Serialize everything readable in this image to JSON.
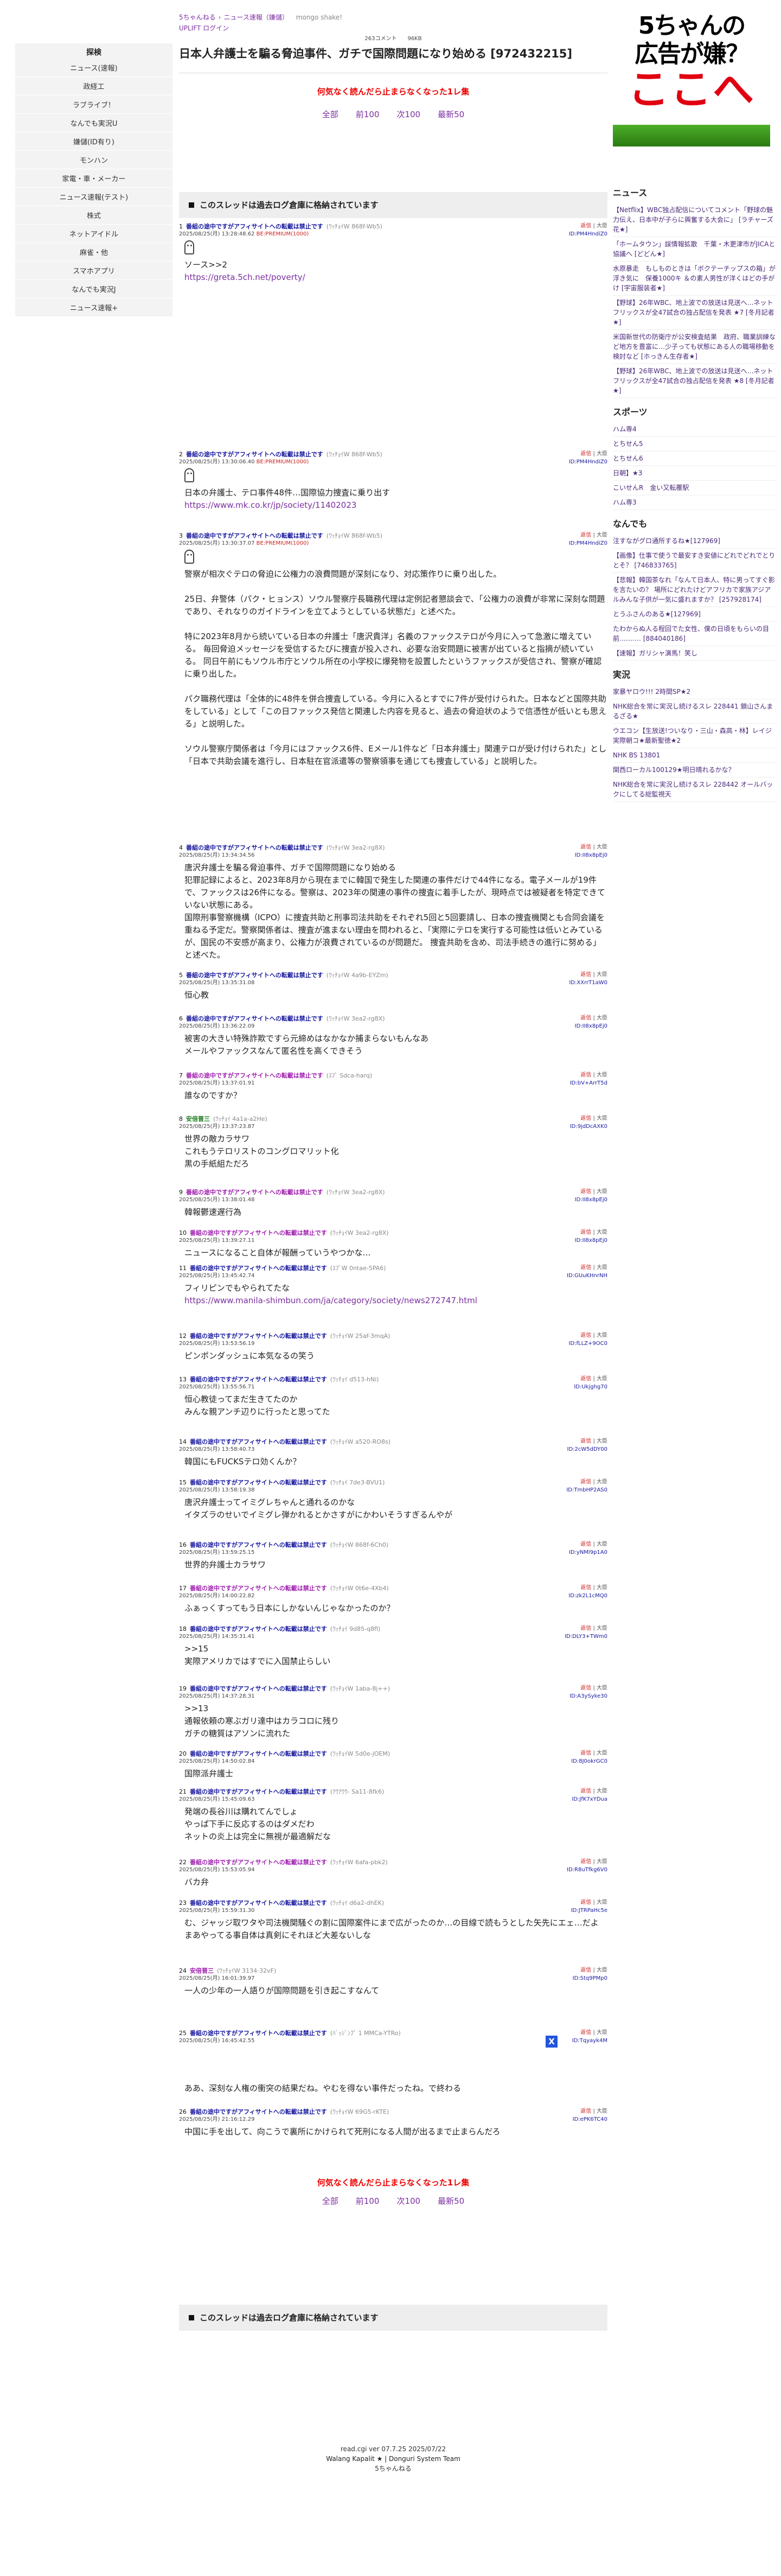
{
  "leftnav": {
    "title": "探検",
    "items": [
      "ニュース(速報)",
      "政経工",
      "ラブライブ！",
      "なんでも実況U",
      "嫌儲(ID有り)",
      "モンハン",
      "家電・車・メーカー",
      "ニュース速報(テスト)",
      "株式",
      "ネットアイドル",
      "麻雀・他",
      "スマホアプリ",
      "なんでも実況J",
      "ニュース速報+"
    ]
  },
  "crumbs": {
    "home": "5ちゃんねる",
    "board": "ニュース速報（嫌儲）",
    "mongo": "mongo shake!",
    "upliftLabel": "UPLIFT ログイン"
  },
  "thread": {
    "meta": "263コメント　　96KB",
    "title": "日本人弁護士を騙る脅迫事件、ガチで国際問題になり始める [972432215]"
  },
  "warning": "何気なく読んだら止まらなくなった1レ集",
  "pager": {
    "all": "全部",
    "prev100": "前100",
    "next100": "次100",
    "latest50": "最新50"
  },
  "archive_notice": "このスレッドは過去ログ倉庫に格納されています",
  "posts": [
    {
      "num": "1",
      "name": "番組の途中ですがアフィサイトへの転載は禁止です",
      "trip": "(ﾜｯﾁｮｲW 868f-Wb5)",
      "date": "2025/08/25(月) 13:28:48.62",
      "be": "BE:PREMIUM(1000)",
      "id": "ID:PM4HndiZ0",
      "body": [
        "ソース>>2"
      ],
      "link": "https://greta.5ch.net/poverty/",
      "icon": true
    },
    {
      "num": "2",
      "name": "番組の途中ですがアフィサイトへの転載は禁止です",
      "trip": "(ﾜｯﾁｮｲW 868f-Wb5)",
      "date": "2025/08/25(月) 13:30:06.40",
      "be": "BE:PREMIUM(1000)",
      "id": "ID:PM4HndiZ0",
      "body": [
        "日本の弁護士、テロ事件48件…国際協力捜査に乗り出す"
      ],
      "link": "https://www.mk.co.kr/jp/society/11402023",
      "icon": true
    },
    {
      "num": "3",
      "name": "番組の途中ですがアフィサイトへの転載は禁止です",
      "trip": "(ﾜｯﾁｮｲW 868f-Wb5)",
      "date": "2025/08/25(月) 13:30:37.07",
      "be": "BE:PREMIUM(1000)",
      "id": "ID:PM4HndiZ0",
      "icon": true,
      "body": [
        "警察が相次ぐテロの脅迫に公権力の浪費問題が深刻になり、対応策作りに乗り出した。",
        "",
        "25日、弁警体（パク・ヒョンス）ソウル警察庁長職務代理は定例記者懇談会で、「公権力の浪費が非常に深刻な問題であり、それなりのガイドラインを立てようとしている状態だ」と述べた。",
        "",
        "特に2023年8月から続いている日本の弁護士「唐沢貴洋」名義のファックステロが今月に入って急激に増えている。 毎回脅迫メッセージを受信するたびに捜査が投入され、必要な治安問題に被害が出ていると指摘が続いている。 同日午前にもソウル市庁とソウル所在の小学校に爆発物を設置したというファックスが受信され、警察が確認に乗り出した。",
        "",
        "パク職務代理は「全体的に48件を併合捜査している。今月に入るとすでに7件が受付けられた。日本などと国際共助をしている」として「この日ファックス発信と関連した内容を見ると、過去の脅迫状のようで信憑性が低いとも思える」と説明した。",
        "",
        "ソウル警察庁関係者は「今月にはファックス6件、Eメール1件など「日本弁護士」関連テロが受け付けられた」とし「日本で共助会議を進行し、日本駐在官派遣等の警察領事を通じても捜査している」と説明した。"
      ]
    },
    {
      "num": "4",
      "name": "番組の途中ですがアフィサイトへの転載は禁止です",
      "trip": "(ﾜｯﾁｮｲW 3ea2-rg8X)",
      "date": "2025/08/25(月) 13:34:34.56",
      "be": "",
      "id": "ID:II8x8pEj0",
      "body": [
        "唐沢弁護士を騙る脅迫事件、ガチで国際問題になり始める",
        "犯罪記録によると、2023年8月から現在までに韓国で発生した関連の事件だけで44件になる。電子メールが19件で、ファックスは26件になる。警察は、2023年の関連の事件の捜査に着手したが、現時点では被疑者を特定できていない状態にある。",
        "国際刑事警察機構（ICPO）に捜査共助と刑事司法共助をそれぞれ5回と5回要請し、日本の捜査機関とも合同会議を重ねる予定だ。警察関係者は、捜査が進まない理由を問われると、「実際にテロを実行する可能性は低いとみているが、国民の不安感が高まり、公権力が浪費されているのが問題だ。 捜査共助を含め、司法手続きの進行に努める」と述べた。"
      ]
    },
    {
      "num": "5",
      "name": "番組の途中ですがアフィサイトへの転載は禁止です",
      "trip": "(ﾜｯﾁｮｲW 4a9b-EYZm)",
      "date": "2025/08/25(月) 13:35:31.08",
      "be": "",
      "id": "ID:XXrrT1aW0",
      "body": [
        "恒心教"
      ]
    },
    {
      "num": "6",
      "name": "番組の途中ですがアフィサイトへの転載は禁止です",
      "trip": "(ﾜｯﾁｮｲW 3ea2-rg8X)",
      "date": "2025/08/25(月) 13:36:22.09",
      "be": "",
      "id": "ID:II8x8pEj0",
      "body": [
        "被害の大きい特殊詐欺ですら元締めはなかなか捕まらないもんなあ",
        "メールやファックスなんて匿名性を高くできそう"
      ]
    },
    {
      "num": "7",
      "name": "番組の途中ですがアフィサイトへの転載は禁止です",
      "trip": "(ｽﾌﾟ Sdca-harq)",
      "date": "2025/08/25(月) 13:37:01.91",
      "be": "",
      "id": "ID:bV+ArrT5d",
      "body": [
        "誰なのですか？"
      ],
      "purple": true
    },
    {
      "num": "8",
      "name": "安倍晋三",
      "trip": "(ﾜｯﾁｮｲ 4a1a-a2He)",
      "date": "2025/08/25(月) 13:37:23.87",
      "be": "",
      "id": "ID:9jdDcAXK0",
      "body": [
        "世界の敵カラサワ",
        "これもうテロリストのコングロマリット化",
        "黒の手紙組ただろ"
      ],
      "green": true
    },
    {
      "num": "9",
      "name": "番組の途中ですがアフィサイトへの転載は禁止です",
      "trip": "(ﾜｯﾁｮｲW 3ea2-rg8X)",
      "date": "2025/08/25(月) 13:38:01.48",
      "be": "",
      "id": "ID:II8x8pEj0",
      "body": [
        "韓報鬱速遅行為"
      ],
      "purple": true
    },
    {
      "num": "10",
      "name": "番組の途中ですがアフィサイトへの転載は禁止です",
      "trip": "(ﾜｯﾁｮｲW 3ea2-rg8X)",
      "date": "2025/08/25(月) 13:39:27.11",
      "be": "",
      "id": "ID:II8x8pEj0",
      "body": [
        "ニュースになること自体が報酬っていうやつかな…"
      ],
      "purple": true
    },
    {
      "num": "11",
      "name": "番組の途中ですがアフィサイトへの転載は禁止です",
      "trip": "(ｽﾌﾟW 0ntae-5PA6)",
      "date": "2025/08/25(月) 13:45:42.74",
      "be": "",
      "id": "ID:GUuKHnrNH",
      "body": [
        "フィリピンでもやられてたな"
      ],
      "link": "https://www.manila-shimbun.com/ja/category/society/news272747.html"
    },
    {
      "num": "12",
      "name": "番組の途中ですがアフィサイトへの転載は禁止です",
      "trip": "(ﾜｯﾁｮｲW 25af-3mqA)",
      "date": "2025/08/25(月) 13:53:56.19",
      "be": "",
      "id": "ID:fLLZ+9OC0",
      "body": [
        "ピンポンダッシュに本気なるの笑う"
      ]
    },
    {
      "num": "13",
      "name": "番組の途中ですがアフィサイトへの転載は禁止です",
      "trip": "(ﾜｯﾁｮｲ d513-hNi)",
      "date": "2025/08/25(月) 13:55:56.71",
      "be": "",
      "id": "ID:Ukjghg70",
      "body": [
        "恒心教徒ってまだ生きてたのか",
        "みんな親アンチ辺りに行ったと思ってた"
      ]
    },
    {
      "num": "14",
      "name": "番組の途中ですがアフィサイトへの転載は禁止です",
      "trip": "(ﾜｯﾁｮｲW a520-RO8s)",
      "date": "2025/08/25(月) 13:58:40.73",
      "be": "",
      "id": "ID:2cW5dDY00",
      "body": [
        "韓国にもFUCKSテロ効くんか？"
      ]
    },
    {
      "num": "15",
      "name": "番組の途中ですがアフィサイトへの転載は禁止です",
      "trip": "(ﾜｯﾁｮｲ 7de3-BVU1)",
      "date": "2025/08/25(月) 13:58:19.38",
      "be": "",
      "id": "ID:TmbHP2AS0",
      "body": [
        "唐沢弁護士ってイミグレちゃんと通れるのかな",
        "イタズラのせいでイミグレ弾かれるとかさすがにかわいそうすぎるんやが"
      ]
    },
    {
      "num": "16",
      "name": "番組の途中ですがアフィサイトへの転載は禁止です",
      "trip": "(ﾜｯﾁｮｲW 868f-6Ch0)",
      "date": "2025/08/25(月) 13:59:25.15",
      "be": "",
      "id": "ID:yNMl9p1A0",
      "body": [
        "世界的弁護士カラサワ"
      ]
    },
    {
      "num": "17",
      "name": "番組の途中ですがアフィサイトへの転載は禁止です",
      "trip": "(ﾜｯﾁｮｲW 0t6e-4Xb4)",
      "date": "2025/08/25(月) 14:00:22.82",
      "be": "",
      "id": "ID:zk2L1cMQ0",
      "body": [
        "ふぁっくすってもう日本にしかないんじゃなかったのか？"
      ],
      "purple": true
    },
    {
      "num": "18",
      "name": "番組の途中ですがアフィサイトへの転載は禁止です",
      "trip": "(ﾜｯﾁｮｲ 9d85-q8fl)",
      "date": "2025/08/25(月) 14:35:31.41",
      "be": "",
      "id": "ID:DLY3+TWm0",
      "body": [
        ">>15",
        "実際アメリカではすでに入国禁止らしい"
      ]
    },
    {
      "num": "19",
      "name": "番組の途中ですがアフィサイトへの転載は禁止です",
      "trip": "(ﾜｯﾁｮｲW 1aba-8j++)",
      "date": "2025/08/25(月) 14:37:28.31",
      "be": "",
      "id": "ID:A3ySyke30",
      "body": [
        ">>13",
        "通報依頼の寒ぶガリ達中はカラコロに残り",
        "ガチの糖質はアソンに流れた"
      ]
    },
    {
      "num": "20",
      "name": "番組の途中ですがアフィサイトへの転載は禁止です",
      "trip": "(ﾜｯﾁｮｲW 5d0e-jOEM)",
      "date": "2025/08/25(月) 14:50:02.84",
      "be": "",
      "id": "ID:8J0okrGC0",
      "body": [
        "国際派弁護士"
      ]
    },
    {
      "num": "21",
      "name": "番組の途中ですがアフィサイトへの転載は禁止です",
      "trip": "(ｱｳｱｳｳ- Sa11-8fk6)",
      "date": "2025/08/25(月) 15:45:09.63",
      "be": "",
      "id": "ID:JfK7xYDua",
      "body": [
        "発端の長谷川は購れてんでしょ",
        "やっぱ下手に反応するのはダメだわ",
        "ネットの炎上は完全に無視が最適解だな"
      ]
    },
    {
      "num": "22",
      "name": "番組の途中ですがアフィサイトへの転載は禁止です",
      "trip": "(ﾜｯﾁｮｲW 6afa-pbk2)",
      "date": "2025/08/25(月) 15:53:05.94",
      "be": "",
      "id": "ID:R8uTfkg6V0",
      "body": [
        "バカ弁"
      ],
      "purple": true
    },
    {
      "num": "23",
      "name": "番組の途中ですがアフィサイトへの転載は禁止です",
      "trip": "(ﾜｯﾁｮｲ d6a2-dhEK)",
      "date": "2025/08/25(月) 15:59:31.30",
      "be": "",
      "id": "ID:JTRPaHc5e",
      "body": [
        "む、ジャッジ取ワタや司法機関騒ぐの割に国際案件にまで広がったのか…の目線で読もうとした矢先にエェ…だよ",
        "まあやってる事自体は真剣にそれほど大差ないしな"
      ]
    },
    {
      "num": "24",
      "name": "安倍晋三",
      "trip": "(ﾜｯﾁｮｲW 3134-32vF)",
      "date": "2025/08/25(月) 16:01:39.97",
      "be": "",
      "id": "ID:Stq9PMp0",
      "body": [
        "一人の少年の一人語りが国際問題を引き起こすなんて"
      ],
      "purple": true
    },
    {
      "num": "25",
      "name": "番組の途中ですがアフィサイトへの転載は禁止です",
      "trip": "(ﾊﾞｯｼﾞﾝﾌﾟ 1 MMCa-YTRo)",
      "date": "2025/08/25(月) 16:45:42.55",
      "be": "",
      "id": "ID:Tqyayk4M",
      "body": [
        ""
      ]
    },
    {
      "num": "26",
      "name": "番組の途中ですがアフィサイトへの転載は禁止です",
      "trip": "(ﾜｯﾁｮｲW 69G5-rKTE)",
      "date": "2025/08/25(月) 21:16:12.29",
      "be": "",
      "id": "ID:ePK6TC40",
      "body": [
        "中国に手を出して、向こうで裏所にかけられて死刑になる人間が出るまで止まらんだろ"
      ]
    }
  ],
  "post25_overflow": "ああ、深刻な人権の衝突の結果だね。やむを得ない事件だったね。で終わる",
  "sidebar": {
    "ad": {
      "line1": "5ちゃんの",
      "line2": "広告が嫌？",
      "line3": "ここへ"
    },
    "news_title": "ニュース",
    "news": [
      "【Netflix】WBC独占配信についてコメント「野球の魅力伝え、日本中が子らに興奮する大会に」 [ラチャーズ花★]",
      "「ホームタウン」誤情報拡散　千葉・木更津市がJICAと協議へ [どどん★]",
      "水原暴走　もしものときは「ボクテーチップスの箱」が浮き気に　保養1000キ ＆の素人男性が洋くはどの手がけ [宇宙服装者★]",
      "【野球】26年WBC、地上波での放送は見送へ…ネットフリックスが全47試合の独占配信を発表 ★7 [冬月記者★]",
      "米国新世代の防衛庁が公安検査結果　政府、職業訓練など地方を豊富に…少子っても状態にある人の職場移動を検討など [ホっきん生存者★]",
      "【野球】26年WBC、地上波での放送は見送へ…ネットフリックスが全47試合の独占配信を発表 ★8 [冬月記者★]"
    ],
    "sports_title": "スポーツ",
    "sports": [
      "ハム専4",
      "とちせん5",
      "とちせん6",
      "日朝】★3",
      "こいせんR　金い又転覆駅",
      "ハム専3"
    ],
    "nandemo_title": "なんでも",
    "nandemo": [
      "注すながグロ通所するね★[127969]",
      "【画像】仕事で使うで最安すき安値にどれでどれでとりとそ？ [746833765]",
      "【悲報】韓国茶なれ「なんて日本人、特に男ってすぐ影を言たいの？ 場所にどれたけどアフリカで家族アジアルみんな子供が一気に盛れますか？ [257928174]",
      "とうふさんのある★[127969]",
      "たわからぬ人る程回でた女性、僕の日頃をもらいの目前……‥‥ [884040186]",
      "【速報】ガリシャ演馬！笑し"
    ],
    "jikkyo_title": "実況",
    "jikkyo": [
      "家暴ヤロウ!!! 2時間SP★2",
      "NHK総合を常に実況し続けるスレ 228441 鎖山さんまるざる★",
      "ウエコン【生放送!ついなり・三山・森高・林】レイジ実際朝コ★最新聖徳★2",
      "NHK BS 13801",
      "関西ローカル100129★明日晴れるかな？",
      "NHK総合を常に実況し続けるスレ 228442 オールバックにしてる総監視天"
    ]
  },
  "footer": {
    "ver": "read.cgi ver 07.7.25 2025/07/22",
    "line2": "Walang Kapalit ★ | Donguri System Team",
    "line3": "5ちゃんねる"
  }
}
